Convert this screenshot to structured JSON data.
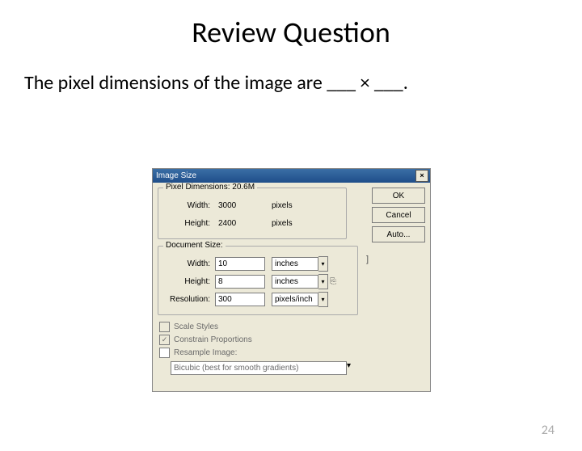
{
  "slide": {
    "title": "Review Question",
    "question": "The pixel dimensions of the image are ___ × ___.",
    "page_number": "24"
  },
  "dialog": {
    "title": "Image Size",
    "close": "×",
    "buttons": {
      "ok": "OK",
      "cancel": "Cancel",
      "auto": "Auto..."
    },
    "pixel_group": {
      "legend": "Pixel Dimensions: 20.6M",
      "width_label": "Width:",
      "width_value": "3000",
      "width_unit": "pixels",
      "height_label": "Height:",
      "height_value": "2400",
      "height_unit": "pixels"
    },
    "doc_group": {
      "legend": "Document Size:",
      "width_label": "Width:",
      "width_value": "10",
      "width_unit": "inches",
      "height_label": "Height:",
      "height_value": "8",
      "height_unit": "inches",
      "res_label": "Resolution:",
      "res_value": "300",
      "res_unit": "pixels/inch"
    },
    "checks": {
      "scale": "Scale Styles",
      "constrain": "Constrain Proportions",
      "resample": "Resample Image:"
    },
    "resample_method": "Bicubic (best for smooth gradients)"
  }
}
